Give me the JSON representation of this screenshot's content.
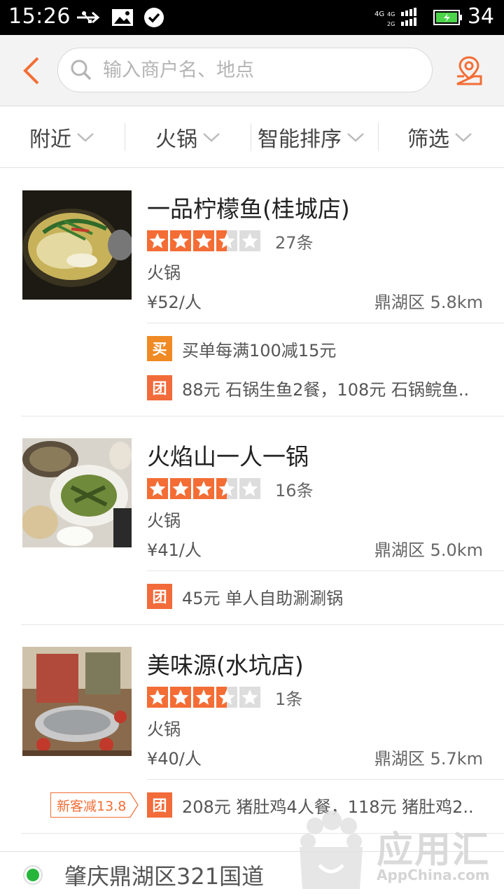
{
  "status_bar": {
    "time": "15:26",
    "battery": "34",
    "network": "4G 4G 2G"
  },
  "search": {
    "placeholder": "输入商户名、地点"
  },
  "filters": [
    {
      "label": "附近"
    },
    {
      "label": "火锅"
    },
    {
      "label": "智能排序"
    },
    {
      "label": "筛选"
    }
  ],
  "colors": {
    "accent": "#f36d35",
    "star": "#f36d35",
    "star_empty": "#dddddd"
  },
  "shops": [
    {
      "name": "一品柠檬鱼(桂城店)",
      "rating": 3.5,
      "reviews": "27条",
      "category": "火锅",
      "price": "¥52/人",
      "location": "鼎湖区 5.8km",
      "deals": [
        {
          "badge": "买",
          "text": "买单每满100减15元"
        },
        {
          "badge": "团",
          "text": "88元 石锅生鱼2餐，108元 石锅鲩鱼.."
        }
      ]
    },
    {
      "name": "火焰山一人一锅",
      "rating": 3.5,
      "reviews": "16条",
      "category": "火锅",
      "price": "¥41/人",
      "location": "鼎湖区 5.0km",
      "deals": [
        {
          "badge": "团",
          "text": "45元 单人自助涮涮锅"
        }
      ]
    },
    {
      "name": "美味源(水坑店)",
      "rating": 3.5,
      "reviews": "1条",
      "category": "火锅",
      "price": "¥40/人",
      "location": "鼎湖区 5.7km",
      "new_customer_tag": "新客减13.8",
      "deals": [
        {
          "badge": "团",
          "text": "208元 猪肚鸡4人餐，118元 猪肚鸡2.."
        }
      ]
    }
  ],
  "footer": {
    "address": "肇庆鼎湖区321国道"
  },
  "watermark": {
    "title": "应用汇",
    "subtitle": "AppChina.com"
  }
}
